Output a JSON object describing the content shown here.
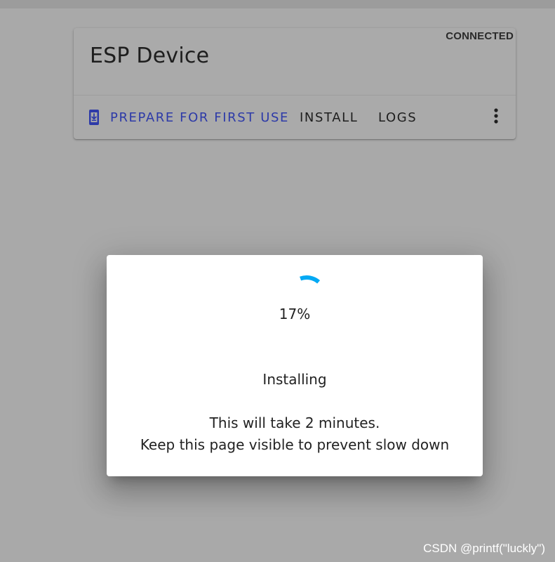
{
  "card": {
    "status": "CONNECTED",
    "title": "ESP Device",
    "actions": {
      "prepare": "PREPARE FOR FIRST USE",
      "install": "INSTALL",
      "logs": "LOGS"
    },
    "icons": {
      "prepare": "install-device-icon",
      "menu": "more-vertical-icon"
    }
  },
  "dialog": {
    "progress_percent": 17,
    "progress_text": "17%",
    "title": "Installing",
    "line1": "This will take 2 minutes.",
    "line2": "Keep this page visible to prevent slow down"
  },
  "colors": {
    "accent": "#2d3aa8",
    "spinner": "#03a9f4",
    "overlay_bg": "#a9a9a9",
    "dialog_bg": "#ffffff"
  },
  "watermark": "CSDN @printf(\"luckly\")"
}
